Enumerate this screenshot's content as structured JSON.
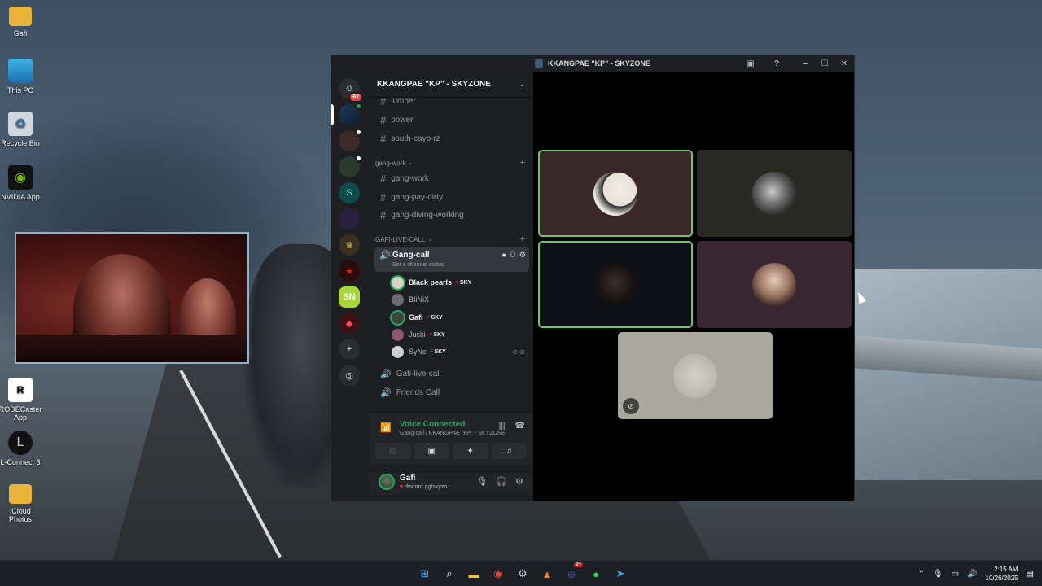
{
  "desktop": {
    "icons": [
      {
        "label": "Gafi",
        "icon": "folder-icon"
      },
      {
        "label": "This PC",
        "icon": "monitor-icon"
      },
      {
        "label": "Recycle Bin",
        "icon": "recycle-bin-icon"
      },
      {
        "label": "NVIDIA App",
        "icon": "nvidia-icon"
      },
      {
        "label": "RODECaster App",
        "icon": "rodecaster-icon"
      },
      {
        "label": "L-Connect 3",
        "icon": "lconnect-icon"
      },
      {
        "label": "iCloud Photos",
        "icon": "icloud-photos-icon"
      }
    ]
  },
  "window": {
    "title": "KKANGPAE \"KP\" - SKYZONE"
  },
  "server_rail": {
    "home_badge": "62"
  },
  "sidebar": {
    "server_name": "KKANGPAE \"KP\" - SKYZONE",
    "channels_top": [
      "lumber",
      "power",
      "south-cayo-rz"
    ],
    "category_work": "gang-work",
    "channels_work": [
      "gang-work",
      "gang-pay-dirty",
      "gang-diving-working"
    ],
    "category_live": "GAFI-LIVE-CALL",
    "active_channel": {
      "name": "Gang-call",
      "status_placeholder": "Set a channel status"
    },
    "voice_users": [
      {
        "name": "Black pearls",
        "tag": "SKY",
        "speaking": true
      },
      {
        "name": "BIiNiX",
        "tag": "",
        "speaking": false
      },
      {
        "name": "Gafi",
        "tag": "SKY",
        "speaking": true
      },
      {
        "name": "Juski",
        "tag": "SKY",
        "speaking": false
      },
      {
        "name": "SyNc",
        "tag": "SKY",
        "speaking": false
      }
    ],
    "voice_channels_after": [
      "Gafi-live-call",
      "Friends Call"
    ]
  },
  "voice_panel": {
    "title": "Voice Connected",
    "subtitle": "Gang-call / KKANGPAE \"KP\" - SKYZONE"
  },
  "user_panel": {
    "username": "Gafi",
    "status": "discord.gg/skyzo..."
  },
  "taskbar": {
    "discord_badge": "9+",
    "time": "2:15 AM",
    "date": "10/26/2025"
  },
  "colors": {
    "accent_green": "#23a55a",
    "speaking_ring": "#6cc56c",
    "danger_red": "#f23f43"
  }
}
